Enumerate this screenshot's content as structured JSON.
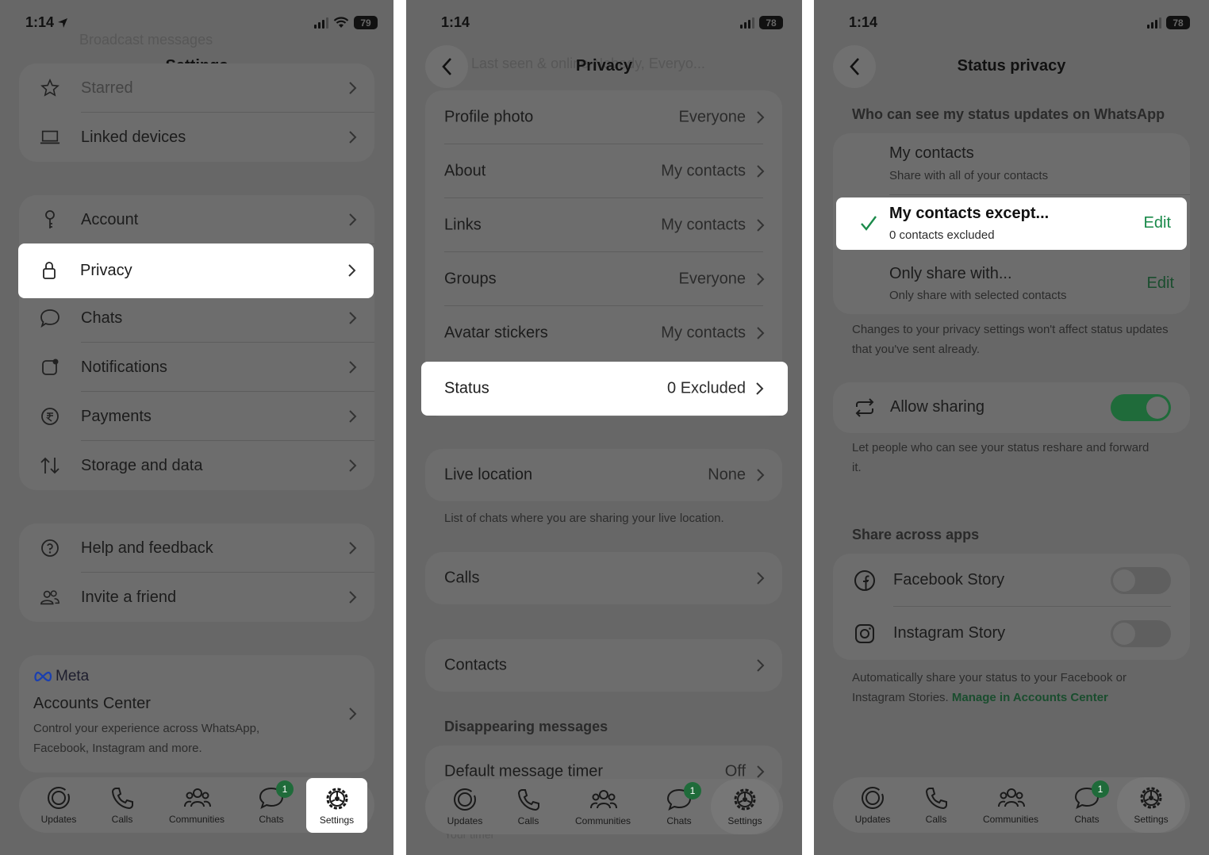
{
  "panel1": {
    "time": "1:14",
    "battery": "79",
    "title": "Settings",
    "ghost_top": "Broadcast messages",
    "group1": [
      {
        "label": "Starred",
        "icon": "star-icon"
      },
      {
        "label": "Linked devices",
        "icon": "laptop-icon"
      }
    ],
    "group2": [
      {
        "label": "Account",
        "icon": "key-icon"
      },
      {
        "label": "Privacy",
        "icon": "lock-icon"
      },
      {
        "label": "Chats",
        "icon": "chat-bubble-icon"
      },
      {
        "label": "Notifications",
        "icon": "notification-icon"
      },
      {
        "label": "Payments",
        "icon": "rupee-icon"
      },
      {
        "label": "Storage and data",
        "icon": "arrows-updown-icon"
      }
    ],
    "group3": [
      {
        "label": "Help and feedback",
        "icon": "help-icon"
      },
      {
        "label": "Invite a friend",
        "icon": "people-icon"
      }
    ],
    "meta": {
      "brand": "Meta",
      "title": "Accounts Center",
      "desc": "Control your experience across WhatsApp, Facebook, Instagram and more."
    },
    "tabs": [
      {
        "label": "Updates",
        "icon": "updates-icon"
      },
      {
        "label": "Calls",
        "icon": "phone-icon"
      },
      {
        "label": "Communities",
        "icon": "communities-icon"
      },
      {
        "label": "Chats",
        "icon": "chats-icon",
        "badge": "1"
      },
      {
        "label": "Settings",
        "icon": "settings-icon",
        "active": true
      }
    ]
  },
  "panel2": {
    "time": "1:14",
    "battery": "78",
    "title": "Privacy",
    "ghost_top": "Last seen & online  Nobody, Everyo...",
    "rows": [
      {
        "label": "Profile photo",
        "value": "Everyone"
      },
      {
        "label": "About",
        "value": "My contacts"
      },
      {
        "label": "Links",
        "value": "My contacts"
      },
      {
        "label": "Groups",
        "value": "Everyone"
      },
      {
        "label": "Avatar stickers",
        "value": "My contacts"
      },
      {
        "label": "Status",
        "value": "0 Excluded"
      }
    ],
    "live_location": {
      "label": "Live location",
      "value": "None"
    },
    "live_caption": "List of chats where you are sharing your live location.",
    "calls": "Calls",
    "contacts": "Contacts",
    "disappearing_header": "Disappearing messages",
    "default_timer": {
      "label": "Default message timer",
      "value": "Off"
    },
    "ghost_bottom": "Your timer",
    "tabs": [
      {
        "label": "Updates",
        "icon": "updates-icon"
      },
      {
        "label": "Calls",
        "icon": "phone-icon"
      },
      {
        "label": "Communities",
        "icon": "communities-icon"
      },
      {
        "label": "Chats",
        "icon": "chats-icon",
        "badge": "1"
      },
      {
        "label": "Settings",
        "icon": "settings-icon",
        "active": true
      }
    ]
  },
  "panel3": {
    "time": "1:14",
    "battery": "78",
    "title": "Status privacy",
    "who_header": "Who can see my status updates on WhatsApp",
    "options": [
      {
        "title": "My contacts",
        "sub": "Share with all of your contacts"
      },
      {
        "title": "My contacts except...",
        "sub": "0 contacts excluded",
        "edit": "Edit",
        "checked": true
      },
      {
        "title": "Only share with...",
        "sub": "Only share with selected contacts",
        "edit": "Edit"
      }
    ],
    "privacy_note": "Changes to your privacy settings won't affect status updates that you've sent already.",
    "allow_sharing": "Allow sharing",
    "allow_sharing_on": true,
    "allow_note": "Let people who can see your status reshare and forward it.",
    "share_header": "Share across apps",
    "apps": [
      {
        "label": "Facebook Story",
        "icon": "facebook-icon",
        "on": false
      },
      {
        "label": "Instagram Story",
        "icon": "instagram-icon",
        "on": false
      }
    ],
    "auto_note": "Automatically share your status to your Facebook or Instagram Stories.",
    "manage_link": "Manage in Accounts Center",
    "tabs": [
      {
        "label": "Updates",
        "icon": "updates-icon"
      },
      {
        "label": "Calls",
        "icon": "phone-icon"
      },
      {
        "label": "Communities",
        "icon": "communities-icon"
      },
      {
        "label": "Chats",
        "icon": "chats-icon",
        "badge": "1"
      },
      {
        "label": "Settings",
        "icon": "settings-icon",
        "active": true
      }
    ]
  },
  "colors": {
    "accent_green": "#1a8a4a",
    "dim_background": "#676767",
    "highlight": "#ffffff",
    "toggle_on": "#1f6b3a"
  }
}
